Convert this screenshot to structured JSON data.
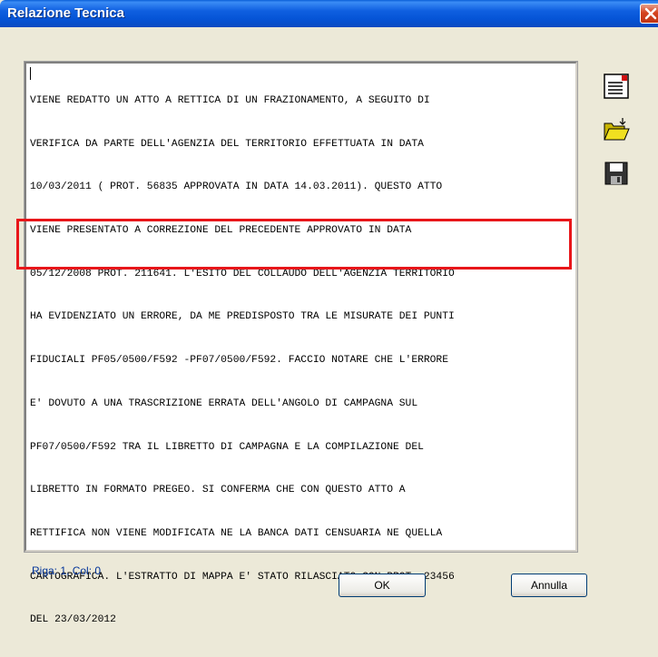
{
  "window": {
    "title": "Relazione Tecnica"
  },
  "textarea": {
    "lines": [
      "VIENE REDATTO UN ATTO A RETTICA DI UN FRAZIONAMENTO, A SEGUITO DI",
      "VERIFICA DA PARTE DELL'AGENZIA DEL TERRITORIO EFFETTUATA IN DATA",
      "10/03/2011 ( PROT. 56835 APPROVATA IN DATA 14.03.2011). QUESTO ATTO",
      "VIENE PRESENTATO A CORREZIONE DEL PRECEDENTE APPROVATO IN DATA",
      "05/12/2008 PROT. 211641. L'ESITO DEL COLLAUDO DELL'AGENZIA TERRITORIO",
      "HA EVIDENZIATO UN ERRORE, DA ME PREDISPOSTO TRA LE MISURATE DEI PUNTI",
      "FIDUCIALI PF05/0500/F592 -PF07/0500/F592. FACCIO NOTARE CHE L'ERRORE",
      "E' DOVUTO A UNA TRASCRIZIONE ERRATA DELL'ANGOLO DI CAMPAGNA SUL",
      "PF07/0500/F592 TRA IL LIBRETTO DI CAMPAGNA E LA COMPILAZIONE DEL",
      "LIBRETTO IN FORMATO PREGEO. SI CONFERMA CHE CON QUESTO ATTO A",
      "RETTIFICA NON VIENE MODIFICATA NE LA BANCA DATI CENSUARIA NE QUELLA",
      "CARTOGRAFICA. L'ESTRATTO DI MAPPA E' STATO RILASCIATO CON PROT. 23456",
      "DEL 23/03/2012"
    ]
  },
  "status": {
    "cursor_position": "Riga: 1, Col: 0"
  },
  "buttons": {
    "ok_label": "OK",
    "cancel_label": "Annulla"
  },
  "toolbar": {
    "icons": [
      "text-document-icon",
      "open-folder-icon",
      "save-floppy-icon"
    ]
  },
  "colors": {
    "titlebar": "#0554d6",
    "highlight_border": "#e8161a",
    "dialog_background": "#ece9d8",
    "status_text": "#003399"
  }
}
